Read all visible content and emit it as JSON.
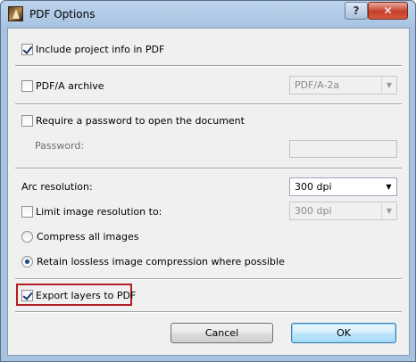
{
  "window": {
    "title": "PDF Options",
    "app_icon": "archicad-icon",
    "help_label": "?",
    "close_label": "✕"
  },
  "options": {
    "include_project_info": {
      "label": "Include project info in PDF",
      "checked": true
    },
    "pdfa_archive": {
      "label": "PDF/A archive",
      "checked": false,
      "select_value": "PDF/A-2a"
    },
    "require_password": {
      "label": "Require a password to open the document",
      "checked": false
    },
    "password": {
      "label": "Password:",
      "value": ""
    },
    "arc_resolution": {
      "label": "Arc resolution:",
      "select_value": "300 dpi"
    },
    "limit_image_resolution": {
      "label": "Limit image resolution to:",
      "checked": false,
      "select_value": "300 dpi"
    },
    "compress_all": {
      "label": "Compress all images",
      "selected": false
    },
    "retain_lossless": {
      "label": "Retain lossless image compression where possible",
      "selected": true
    },
    "export_layers": {
      "label": "Export layers to PDF",
      "checked": true
    }
  },
  "buttons": {
    "cancel": "Cancel",
    "ok": "OK"
  },
  "colors": {
    "highlight_border": "#b21e23",
    "title_bar": "#a8c3e2"
  }
}
